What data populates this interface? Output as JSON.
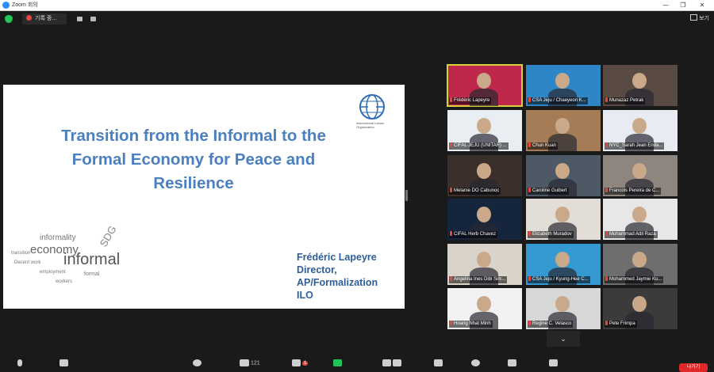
{
  "window": {
    "title": "Zoom 회의",
    "minimize": "—",
    "restore": "❐",
    "close": "✕"
  },
  "topbar": {
    "recording_label": "기록 중...",
    "view_label": "보기"
  },
  "slide": {
    "title": "Transition from the Informal to the Formal Economy for Peace and Resilience",
    "org_logo_text": "International Labour Organization",
    "wordcloud": [
      "informality",
      "economy",
      "SDG",
      "informal",
      "Decent work",
      "employment",
      "formal",
      "transition",
      "workers"
    ],
    "speaker": {
      "name": "Frédéric Lapeyre",
      "role": "Director,",
      "dept": "AP/Formalization",
      "org": "ILO"
    }
  },
  "participants": [
    {
      "name": "Frédéric Lapeyre",
      "color": "#c0284b",
      "active": true
    },
    {
      "name": "CSA Jeju / Chaeyeon K...",
      "color": "#2f86c6"
    },
    {
      "name": "Munazaz Petrak",
      "color": "#5a4a44"
    },
    {
      "name": "CIFAL JEJU (UNITAR) ...",
      "color": "#e9eef3"
    },
    {
      "name": "Chun Kuan",
      "color": "#a57c55"
    },
    {
      "name": "NYC_Sarah Jean Enda...",
      "color": "#e8ecf2"
    },
    {
      "name": "Melanie DO Cabunoc",
      "color": "#3a2f2b"
    },
    {
      "name": "Caroline Guibert",
      "color": "#4d5a66"
    },
    {
      "name": "Francois Pereira de C...",
      "color": "#8e857f"
    },
    {
      "name": "CIFAL Herb Chavez",
      "color": "#14253d"
    },
    {
      "name": "Elizabeth Muradov",
      "color": "#e2ddd6"
    },
    {
      "name": "Muhammad Adil Raza",
      "color": "#e7e7e7"
    },
    {
      "name": "Angelina Ines Dibi Sim...",
      "color": "#d9d3c9"
    },
    {
      "name": "CSA Jeju / Kyung-Hee C...",
      "color": "#3599d2"
    },
    {
      "name": "Mohammed Jaymie Ku...",
      "color": "#6e6e6e"
    },
    {
      "name": "Hoang Nhat Minh",
      "color": "#f2f2f2"
    },
    {
      "name": "Regine C. Velasco",
      "color": "#d8d8d8"
    },
    {
      "name": "Pete Frimpa",
      "color": "#3b3b3b"
    }
  ],
  "toolbar": {
    "participants_count": "121",
    "chat_badge": "1",
    "end_label": "나가기"
  },
  "colors": {
    "accent_blue": "#4a7fc1",
    "active_border": "#d7d23a",
    "end_red": "#e02828"
  }
}
